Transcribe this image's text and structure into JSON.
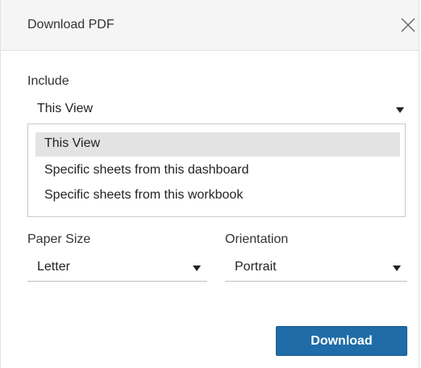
{
  "dialog": {
    "title": "Download PDF",
    "close_icon": "close-icon"
  },
  "include": {
    "label": "Include",
    "selected": "This View",
    "options": [
      "This View",
      "Specific sheets from this dashboard",
      "Specific sheets from this workbook"
    ]
  },
  "paper_size": {
    "label": "Paper Size",
    "selected": "Letter"
  },
  "orientation": {
    "label": "Orientation",
    "selected": "Portrait"
  },
  "actions": {
    "download_label": "Download",
    "download_color": "#1f6ca8"
  }
}
